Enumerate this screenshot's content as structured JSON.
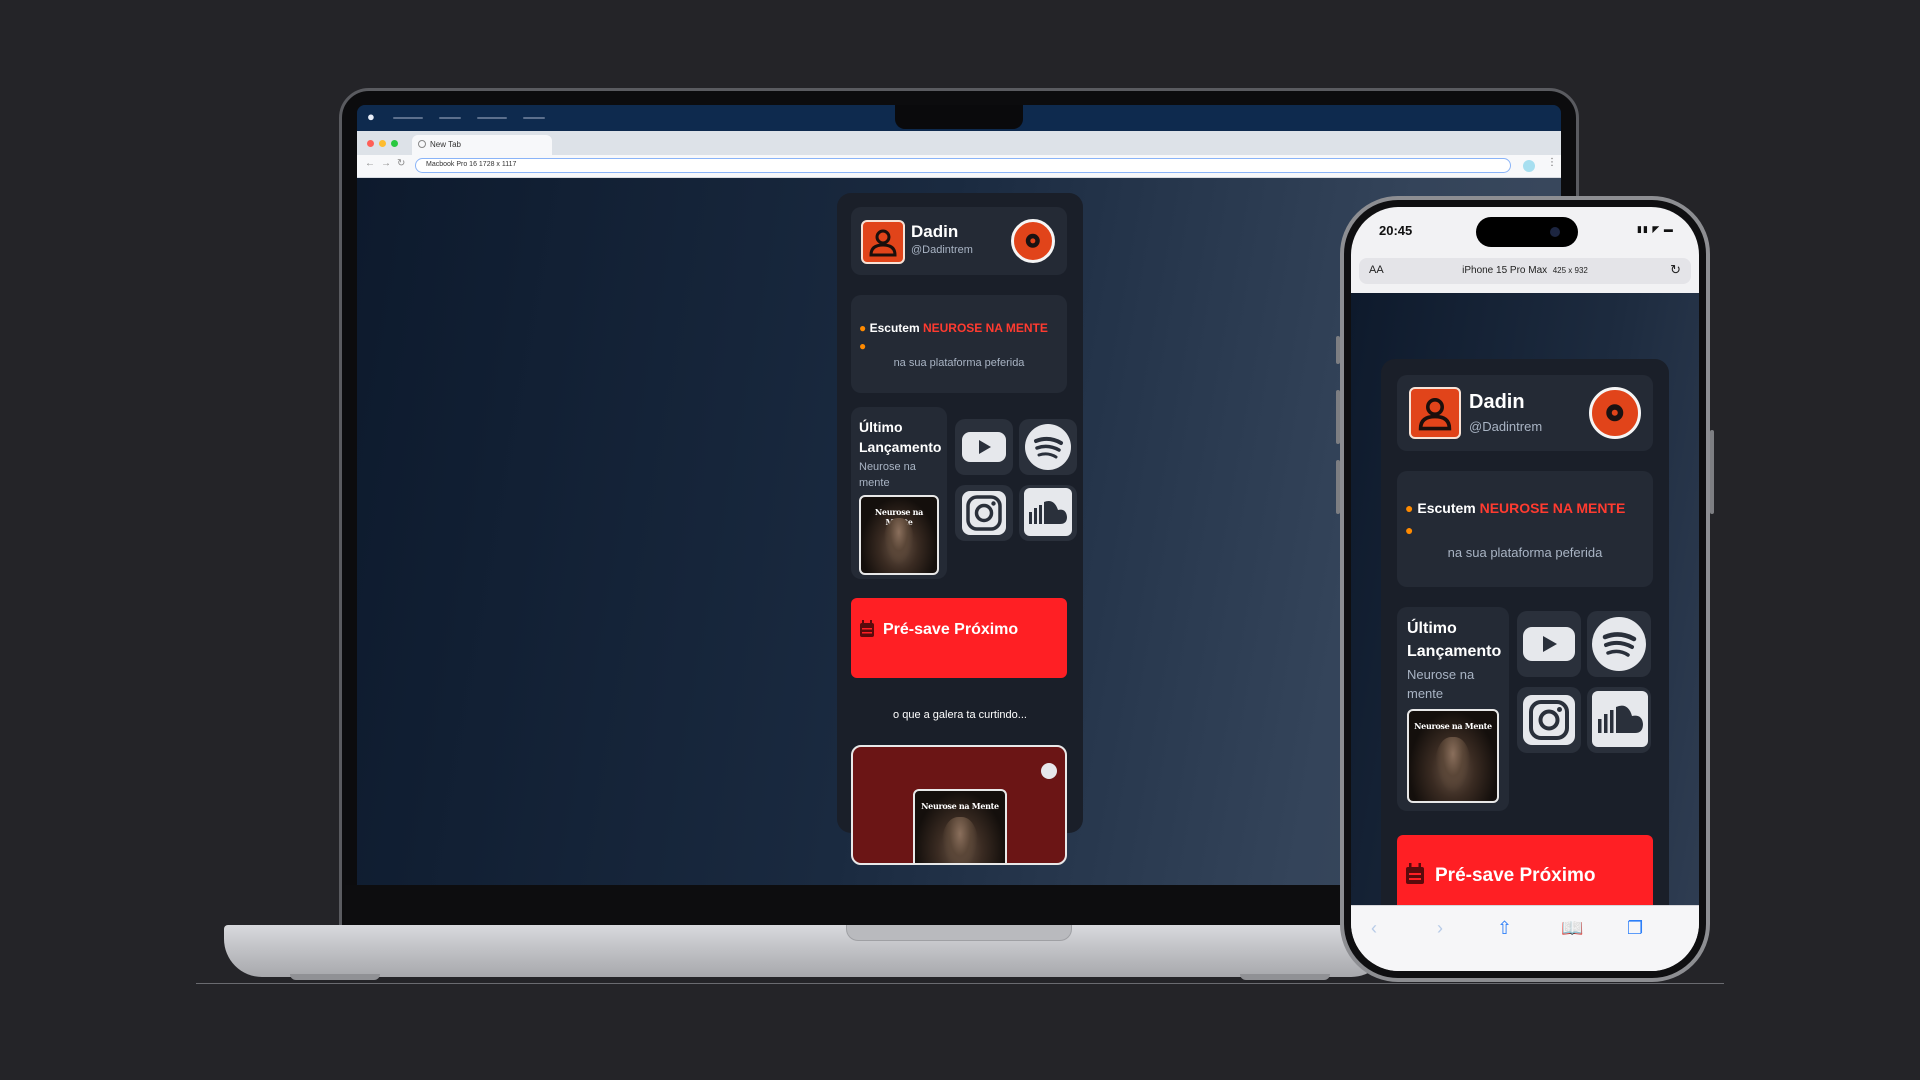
{
  "laptop": {
    "browser": {
      "tab_title": "New Tab",
      "url": "Macbook Pro 16   1728 x 1117",
      "apple_logo": "apple-logo-icon",
      "traffic_lights": [
        "#ff5f57",
        "#febc2e",
        "#28c840"
      ]
    }
  },
  "phone": {
    "time": "20:45",
    "status_icons": "signal-wifi-battery",
    "device_label": "iPhone 15 Pro Max",
    "device_size": "425 x 932",
    "text_size_button": "AA",
    "bottom_bar": [
      "back-icon",
      "forward-icon",
      "share-icon",
      "bookmarks-icon",
      "tabs-icon"
    ]
  },
  "profile": {
    "name": "Dadin",
    "handle": "@Dadintrem",
    "avatar_icon": "user-icon",
    "badge_icon": "vinyl-disc-icon"
  },
  "promo": {
    "prefix": "Escutem ",
    "highlight": "NEUROSE NA MENTE",
    "emoji_icon": "fire-icon",
    "subtitle": "na sua plataforma peferida"
  },
  "release": {
    "title": "Último Lançamento",
    "title_line1": "Último",
    "title_line2": "Lançamento",
    "track": "Neurose na mente",
    "cover_text": "Neurose na Mente"
  },
  "socials": [
    {
      "name": "YouTube",
      "icon": "youtube-icon"
    },
    {
      "name": "Spotify",
      "icon": "spotify-icon"
    },
    {
      "name": "Instagram",
      "icon": "instagram-icon"
    },
    {
      "name": "SoundCloud",
      "icon": "soundcloud-icon"
    }
  ],
  "presave": {
    "label": "Pré-save Próximo",
    "icon": "calendar-icon"
  },
  "trending": {
    "caption": "o que a galera ta curtindo...",
    "card_icon": "spotify-icon",
    "cover_text": "Neurose na Mente"
  },
  "colors": {
    "accent_red": "#ff1f24",
    "highlight_red": "#ff3b30",
    "avatar_orange": "#e1441a",
    "panel": "#1a1f29",
    "card": "#242a35",
    "trending_card": "#6b1515",
    "backdrop": "#242428"
  }
}
